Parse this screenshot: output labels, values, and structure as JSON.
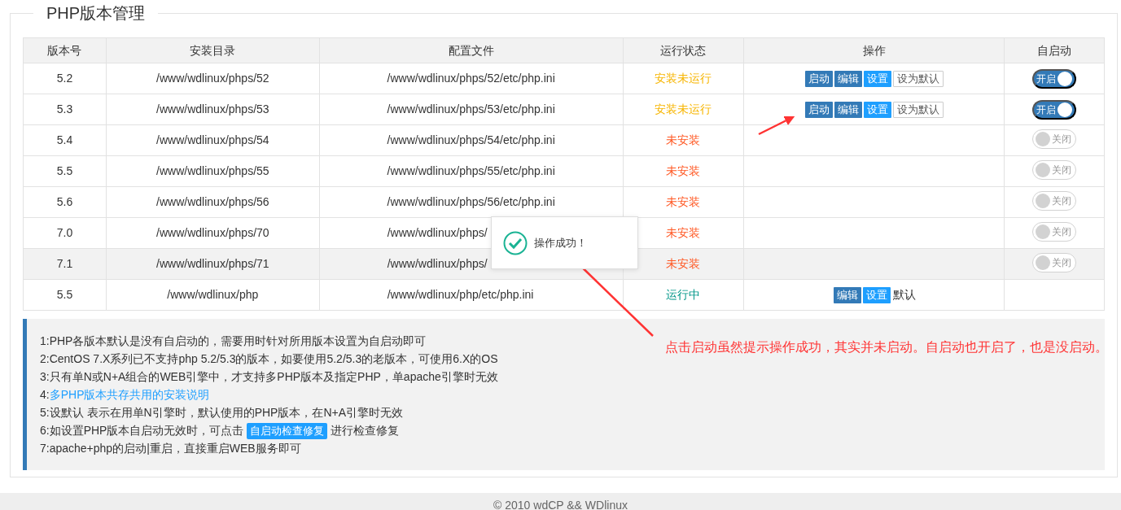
{
  "panel": {
    "title": "PHP版本管理"
  },
  "table": {
    "columns": [
      "版本号",
      "安装目录",
      "配置文件",
      "运行状态",
      "操作",
      "自启动"
    ],
    "rows": [
      {
        "version": "5.2",
        "dir": "/www/wdlinux/phps/52",
        "config": "/www/wdlinux/phps/52/etc/php.ini",
        "status": {
          "text": "安装未运行",
          "kind": "stopped"
        },
        "hovered": false,
        "actions": [
          {
            "label": "启动",
            "kind": "primary"
          },
          {
            "label": "编辑",
            "kind": "primary"
          },
          {
            "label": "设置",
            "kind": "info"
          },
          {
            "label": "设为默认",
            "kind": "default"
          }
        ],
        "autostart": {
          "on": true,
          "label": "开启"
        }
      },
      {
        "version": "5.3",
        "dir": "/www/wdlinux/phps/53",
        "config": "/www/wdlinux/phps/53/etc/php.ini",
        "status": {
          "text": "安装未运行",
          "kind": "stopped"
        },
        "hovered": false,
        "actions": [
          {
            "label": "启动",
            "kind": "primary"
          },
          {
            "label": "编辑",
            "kind": "primary"
          },
          {
            "label": "设置",
            "kind": "info"
          },
          {
            "label": "设为默认",
            "kind": "default"
          }
        ],
        "autostart": {
          "on": true,
          "label": "开启"
        }
      },
      {
        "version": "5.4",
        "dir": "/www/wdlinux/phps/54",
        "config": "/www/wdlinux/phps/54/etc/php.ini",
        "status": {
          "text": "未安装",
          "kind": "missing"
        },
        "hovered": false,
        "autostart": {
          "on": false,
          "label": "关闭"
        }
      },
      {
        "version": "5.5",
        "dir": "/www/wdlinux/phps/55",
        "config": "/www/wdlinux/phps/55/etc/php.ini",
        "status": {
          "text": "未安装",
          "kind": "missing"
        },
        "hovered": false,
        "autostart": {
          "on": false,
          "label": "关闭"
        }
      },
      {
        "version": "5.6",
        "dir": "/www/wdlinux/phps/56",
        "config": "/www/wdlinux/phps/56/etc/php.ini",
        "status": {
          "text": "未安装",
          "kind": "missing"
        },
        "hovered": false,
        "autostart": {
          "on": false,
          "label": "关闭"
        }
      },
      {
        "version": "7.0",
        "dir": "/www/wdlinux/phps/70",
        "config": "/www/wdlinux/phps/",
        "status": {
          "text": "未安装",
          "kind": "missing"
        },
        "hovered": false,
        "autostart": {
          "on": false,
          "label": "关闭"
        }
      },
      {
        "version": "7.1",
        "dir": "/www/wdlinux/phps/71",
        "config": "/www/wdlinux/phps/",
        "status": {
          "text": "未安装",
          "kind": "missing"
        },
        "hovered": true,
        "autostart": {
          "on": false,
          "label": "关闭"
        }
      },
      {
        "version": "5.5",
        "dir": "/www/wdlinux/php",
        "config": "/www/wdlinux/php/etc/php.ini",
        "status": {
          "text": "运行中",
          "kind": "running"
        },
        "hovered": false,
        "actions": [
          {
            "label": "编辑",
            "kind": "primary"
          },
          {
            "label": "设置",
            "kind": "info"
          },
          {
            "label": "默认",
            "kind": "text"
          }
        ]
      }
    ]
  },
  "notes": [
    {
      "kind": "text",
      "text": "1:PHP各版本默认是没有自启动的，需要用时针对所用版本设置为自启动即可"
    },
    {
      "kind": "text",
      "text": "2:CentOS 7.X系列已不支持php 5.2/5.3的版本，如要使用5.2/5.3的老版本，可使用6.X的OS"
    },
    {
      "kind": "text",
      "text": "3:只有单N或N+A组合的WEB引擎中，才支持多PHP版本及指定PHP，单apache引擎时无效"
    },
    {
      "kind": "link",
      "prefix": "4:",
      "link": "多PHP版本共存共用的安装说明"
    },
    {
      "kind": "text",
      "text": "5:设默认 表示在用单N引擎时，默认使用的PHP版本，在N+A引擎时无效"
    },
    {
      "kind": "button",
      "prefix": "6:如设置PHP版本自启动无效时，可点击",
      "button": "自启动检查修复",
      "suffix": "进行检查修复"
    },
    {
      "kind": "text",
      "text": "7:apache+php的启动|重启，直接重启WEB服务即可"
    }
  ],
  "toast": {
    "text": "操作成功！"
  },
  "annotation": {
    "text": "点击启动虽然提示操作成功，其实并未启动。自启动也开启了，也是没启动。"
  },
  "footer": {
    "text": "© 2010 wdCP && WDlinux"
  }
}
